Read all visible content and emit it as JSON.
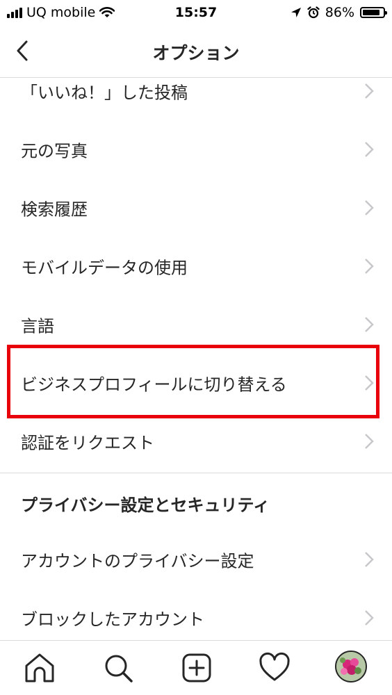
{
  "status_bar": {
    "carrier": "UQ mobile",
    "time": "15:57",
    "battery_percent": "86%",
    "battery_level": 0.86,
    "icons": [
      "signal-icon",
      "wifi-icon",
      "location-icon",
      "alarm-icon",
      "battery-icon"
    ]
  },
  "header": {
    "title": "オプション",
    "back_icon": "chevron-left-icon"
  },
  "menu": {
    "items": [
      {
        "label": "「いいね！」した投稿"
      },
      {
        "label": "元の写真"
      },
      {
        "label": "検索履歴"
      },
      {
        "label": "モバイルデータの使用"
      },
      {
        "label": "言語"
      },
      {
        "label": "ビジネスプロフィールに切り替える",
        "highlighted": true
      },
      {
        "label": "認証をリクエスト"
      }
    ],
    "privacy_section": {
      "title": "プライバシー設定とセキュリティ",
      "items": [
        {
          "label": "アカウントのプライバシー設定"
        },
        {
          "label": "ブロックしたアカウント"
        }
      ]
    }
  },
  "highlight_color": "#e8000b",
  "tab_bar": {
    "tabs": [
      "home-icon",
      "search-icon",
      "new-post-icon",
      "heart-icon",
      "profile-avatar"
    ]
  }
}
